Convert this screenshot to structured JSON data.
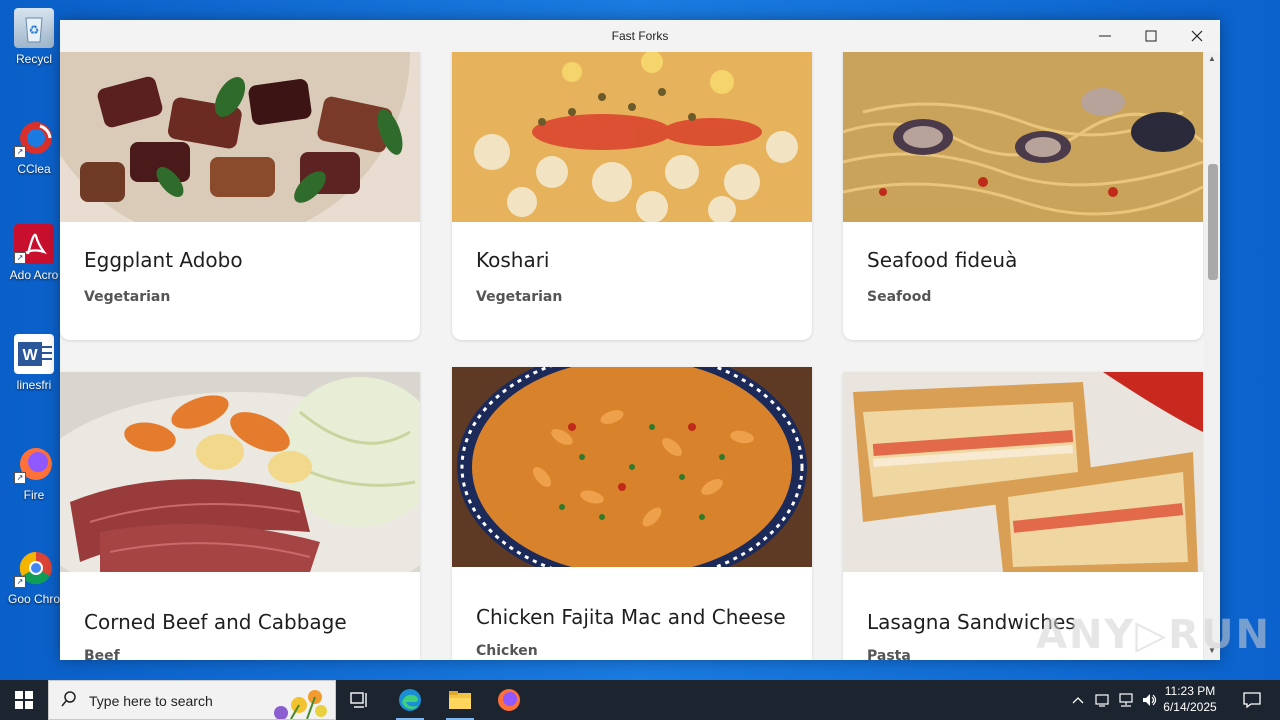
{
  "desktop": {
    "icons": [
      {
        "label": "Recycl",
        "icon": "recycle-bin-icon"
      },
      {
        "label": "CClea",
        "icon": "ccleaner-icon"
      },
      {
        "label": "Ado Acro",
        "icon": "adobe-acrobat-icon"
      },
      {
        "label": "linesfri",
        "icon": "word-document-icon"
      },
      {
        "label": "Fire",
        "icon": "firefox-icon"
      },
      {
        "label": "Goo Chro",
        "icon": "chrome-icon"
      }
    ]
  },
  "window": {
    "title": "Fast Forks",
    "minimize_glyph": "—",
    "maximize_glyph": "☐",
    "close_glyph": "✕"
  },
  "recipes": [
    {
      "name": "Eggplant Adobo",
      "category": "Vegetarian",
      "image": "eggplant-adobo-photo"
    },
    {
      "name": "Koshari",
      "category": "Vegetarian",
      "image": "koshari-photo"
    },
    {
      "name": "Seafood fideuà",
      "category": "Seafood",
      "image": "seafood-fideua-photo"
    },
    {
      "name": "Corned Beef and Cabbage",
      "category": "Beef",
      "image": "corned-beef-photo"
    },
    {
      "name": "Chicken Fajita Mac and Cheese",
      "category": "Chicken",
      "image": "fajita-mac-photo"
    },
    {
      "name": "Lasagna Sandwiches",
      "category": "Pasta",
      "image": "lasagna-sandwich-photo"
    }
  ],
  "scroll": {
    "up_glyph": "▲",
    "down_glyph": "▼",
    "position": 0.19
  },
  "watermark": {
    "text": "ANY▷RUN"
  },
  "taskbar": {
    "search_placeholder": "Type here to search",
    "apps": [
      "task-view-icon",
      "edge-icon",
      "file-explorer-icon",
      "firefox-icon"
    ],
    "time": "11:23 PM",
    "date": "6/14/2025",
    "tray_icons": [
      "chevron-up-icon",
      "meet-now-icon",
      "network-icon",
      "volume-icon"
    ]
  }
}
